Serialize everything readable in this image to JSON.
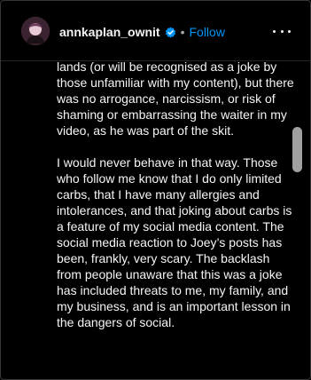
{
  "post_header": {
    "username": "annkaplan_ownit",
    "separator": "•",
    "follow_label": "Follow",
    "verified_icon": "verified-badge-icon",
    "more_icon": "more-options-icon",
    "colors": {
      "follow": "#0095f6",
      "verified": "#0095f6"
    }
  },
  "caption": {
    "paragraphs": [
      "lands (or will be recognised as a joke by those unfamiliar with my content), but there was no arrogance, narcissism, or risk of shaming or embarrassing the waiter in my video, as he was part of the skit.",
      "I would never behave in that way. Those who follow me know that I do only limited carbs, that I have many allergies and intolerances, and that joking about carbs is a feature of my social media content.  The social media reaction to Joey’s posts has been, frankly, very scary.  The backlash from people unaware that this was a joke has included threats to me, my family, and my business, and is an important lesson in the dangers of social."
    ]
  },
  "scroll": {
    "position_fraction": 0.26
  }
}
